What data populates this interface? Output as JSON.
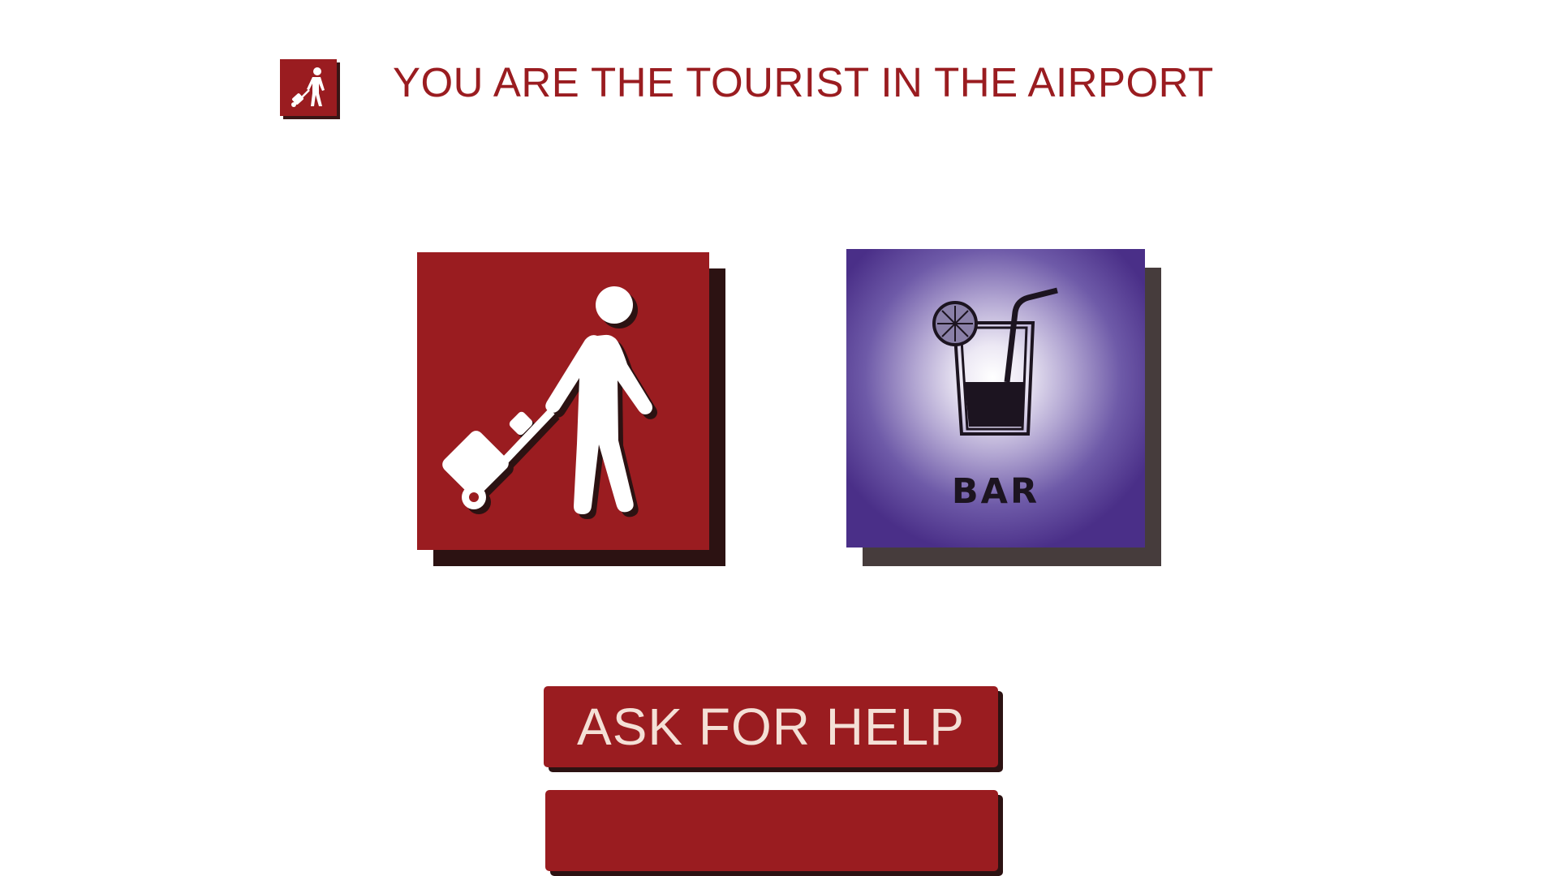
{
  "header": {
    "icon": "tourist-luggage-icon",
    "title": "YOU ARE THE TOURIST IN THE AIRPORT"
  },
  "cards": {
    "tourist": {
      "icon": "tourist-with-suitcase-icon",
      "color": "#9a1c20"
    },
    "bar": {
      "icon": "cocktail-glass-icon",
      "label": "BAR",
      "color": "#4a2f88"
    }
  },
  "actions": {
    "help_label": "ASK FOR HELP",
    "second_label": ""
  },
  "colors": {
    "accent": "#9a1c20",
    "shadow": "#2c1212",
    "bar_purple": "#4a2f88",
    "button_text": "#f4e0d6"
  }
}
